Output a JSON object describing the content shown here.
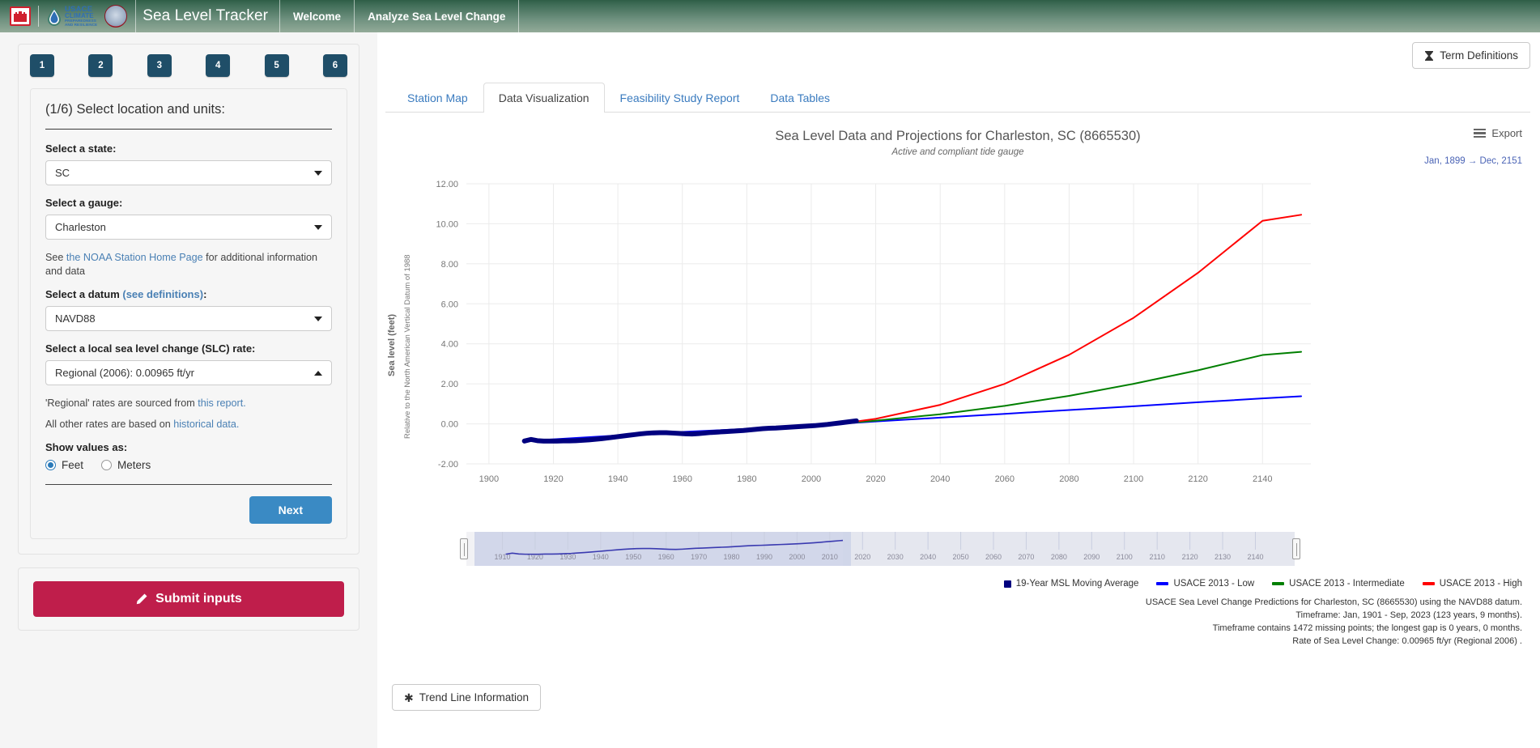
{
  "navbar": {
    "brand_title": "Sea Level Tracker",
    "usace_logo": {
      "line1": "USACE",
      "line2": "CLIMATE",
      "line3": "PREPAREDNESS",
      "line4": "AND RESILIENCE"
    },
    "items": [
      {
        "label": "Welcome"
      },
      {
        "label": "Analyze Sea Level Change"
      }
    ]
  },
  "sidebar": {
    "steps": [
      "1",
      "2",
      "3",
      "4",
      "5",
      "6"
    ],
    "panel_title": "(1/6) Select location and units:",
    "state_label": "Select a state:",
    "state_value": "SC",
    "gauge_label": "Select a gauge:",
    "gauge_value": "Charleston",
    "noaa_note_pre": "See ",
    "noaa_note_link": "the NOAA Station Home Page",
    "noaa_note_post": " for additional information and data",
    "datum_label_pre": "Select a datum ",
    "datum_label_link": "(see definitions)",
    "datum_label_post": ":",
    "datum_value": "NAVD88",
    "slc_label": "Select a local sea level change (SLC) rate:",
    "slc_value": "Regional (2006): 0.00965 ft/yr",
    "regional_note_pre": "'Regional' rates are sourced from ",
    "regional_note_link": "this report.",
    "other_note_pre": "All other rates are based on ",
    "other_note_link": "historical data.",
    "units_label": "Show values as:",
    "unit_feet": "Feet",
    "unit_meters": "Meters",
    "unit_selected": "Feet",
    "next_label": "Next",
    "submit_label": "Submit inputs",
    "submit_icon": "pencil-icon"
  },
  "main": {
    "term_definitions_label": "Term Definitions",
    "term_definitions_icon": "hourglass-icon",
    "tabs": [
      {
        "label": "Station Map",
        "active": false
      },
      {
        "label": "Data Visualization",
        "active": true
      },
      {
        "label": "Feasibility Study Report",
        "active": false
      },
      {
        "label": "Data Tables",
        "active": false
      }
    ],
    "export_label": "Export",
    "export_icon": "hamburger-menu-icon",
    "range_label": "Jan, 1899 → Dec, 2151",
    "trend_button_label": "Trend Line Information",
    "trend_button_icon": "asterisk-icon"
  },
  "chart_data": {
    "type": "line",
    "title": "Sea Level Data and Projections for Charleston, SC (8665530)",
    "subtitle": "Active and compliant tide gauge",
    "ylabel": "Sea level (feet)",
    "ylabel_sub": "Relative to the North American Vertical Datum of 1988",
    "xlabel": "",
    "xlim": [
      1893,
      2155
    ],
    "ylim": [
      -2.0,
      12.0
    ],
    "yticks": [
      "12.00",
      "10.00",
      "8.00",
      "6.00",
      "4.00",
      "2.00",
      "0.00",
      "-2.00"
    ],
    "ytick_values": [
      12,
      10,
      8,
      6,
      4,
      2,
      0,
      -2
    ],
    "xticks": [
      1900,
      1920,
      1940,
      1960,
      1980,
      2000,
      2020,
      2040,
      2060,
      2080,
      2100,
      2120,
      2140
    ],
    "grid": true,
    "legend_position": "bottom-right",
    "series": [
      {
        "name": "19-Year MSL Moving Average",
        "color": "#00007f",
        "marker": "square",
        "x": [
          1911,
          1913,
          1915,
          1917,
          1919,
          1921,
          1923,
          1925,
          1927,
          1929,
          1931,
          1933,
          1935,
          1937,
          1939,
          1941,
          1943,
          1945,
          1947,
          1949,
          1951,
          1953,
          1955,
          1957,
          1959,
          1961,
          1963,
          1965,
          1967,
          1969,
          1971,
          1973,
          1975,
          1977,
          1979,
          1981,
          1983,
          1985,
          1987,
          1989,
          1991,
          1993,
          1995,
          1997,
          1999,
          2001,
          2003,
          2005,
          2007,
          2009,
          2011,
          2013,
          2014
        ],
        "y": [
          -0.86,
          -0.78,
          -0.84,
          -0.86,
          -0.86,
          -0.86,
          -0.85,
          -0.85,
          -0.84,
          -0.82,
          -0.8,
          -0.77,
          -0.74,
          -0.7,
          -0.66,
          -0.62,
          -0.58,
          -0.54,
          -0.5,
          -0.47,
          -0.45,
          -0.44,
          -0.44,
          -0.46,
          -0.48,
          -0.5,
          -0.51,
          -0.49,
          -0.46,
          -0.43,
          -0.41,
          -0.39,
          -0.37,
          -0.35,
          -0.33,
          -0.3,
          -0.27,
          -0.24,
          -0.22,
          -0.21,
          -0.19,
          -0.17,
          -0.15,
          -0.13,
          -0.11,
          -0.09,
          -0.06,
          -0.03,
          0.01,
          0.05,
          0.09,
          0.13,
          0.15
        ]
      },
      {
        "name": "USACE 2013 - Low",
        "color": "#0000ff",
        "marker": "line",
        "x": [
          1911,
          1950,
          1992,
          2000,
          2020,
          2040,
          2060,
          2080,
          2100,
          2120,
          2140,
          2152
        ],
        "y": [
          -0.86,
          -0.48,
          -0.16,
          -0.08,
          0.12,
          0.31,
          0.5,
          0.69,
          0.88,
          1.08,
          1.27,
          1.38
        ]
      },
      {
        "name": "USACE 2013 - Intermediate",
        "color": "#007f00",
        "marker": "line",
        "x": [
          1992,
          2000,
          2014,
          2020,
          2040,
          2060,
          2080,
          2100,
          2120,
          2140,
          2152
        ],
        "y": [
          -0.16,
          -0.08,
          0.08,
          0.16,
          0.48,
          0.9,
          1.4,
          2.0,
          2.68,
          3.44,
          3.6
        ]
      },
      {
        "name": "USACE 2013 - High",
        "color": "#ff0000",
        "marker": "line",
        "x": [
          1992,
          2000,
          2014,
          2020,
          2040,
          2060,
          2080,
          2100,
          2120,
          2140,
          2152
        ],
        "y": [
          -0.16,
          -0.07,
          0.12,
          0.25,
          0.95,
          2.0,
          3.45,
          5.3,
          7.55,
          10.15,
          10.45
        ]
      }
    ],
    "range_slider": {
      "ticks": [
        1910,
        1920,
        1930,
        1940,
        1950,
        1960,
        1970,
        1980,
        1990,
        2000,
        2010,
        2020,
        2030,
        2040,
        2050,
        2060,
        2070,
        2080,
        2090,
        2100,
        2110,
        2120,
        2130,
        2140
      ],
      "selection_start": 1899,
      "selection_end": 2014
    },
    "annotations": [
      "USACE Sea Level Change Predictions for Charleston, SC (8665530) using the NAVD88 datum.",
      "Timeframe: Jan, 1901 - Sep, 2023 (123 years, 9 months).",
      "Timeframe contains 1472 missing points; the longest gap is 0 years, 0 months.",
      "Rate of Sea Level Change: 0.00965 ft/yr (Regional 2006) ."
    ]
  }
}
